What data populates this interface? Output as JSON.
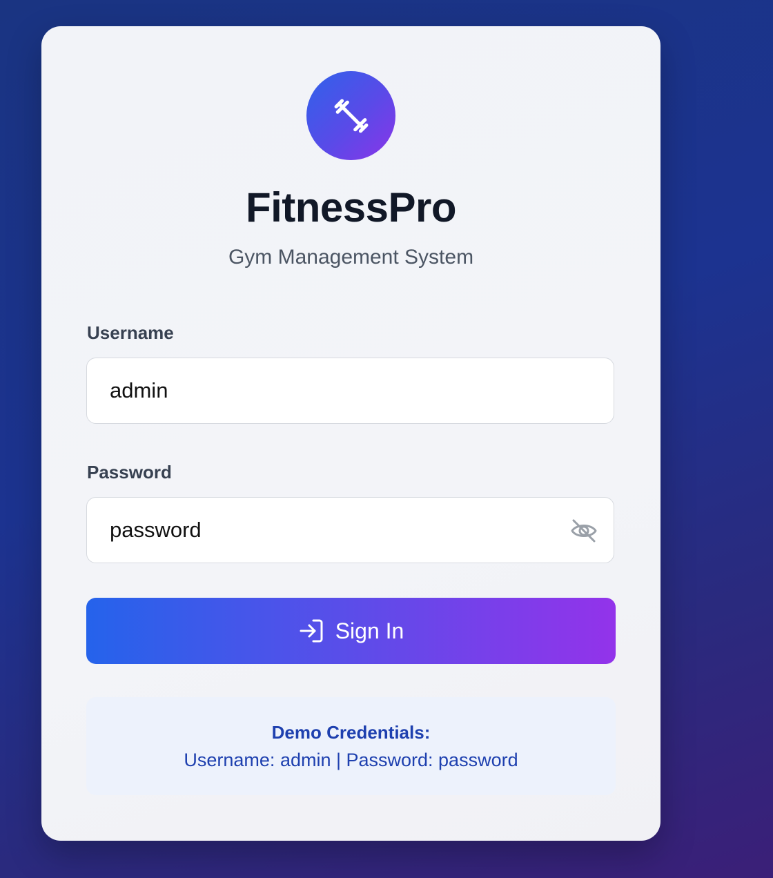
{
  "app": {
    "name": "FitnessPro",
    "subtitle": "Gym Management System",
    "logo_icon": "dumbbell-icon"
  },
  "form": {
    "username": {
      "label": "Username",
      "value": "admin"
    },
    "password": {
      "label": "Password",
      "value": "password",
      "visibility_icon": "eye-off-icon"
    },
    "submit": {
      "label": "Sign In",
      "icon": "login-icon"
    }
  },
  "demo": {
    "heading": "Demo Credentials:",
    "text": "Username: admin | Password: password"
  },
  "colors": {
    "accent_start": "#2563eb",
    "accent_end": "#9333ea",
    "demo_text": "#1e40af"
  }
}
